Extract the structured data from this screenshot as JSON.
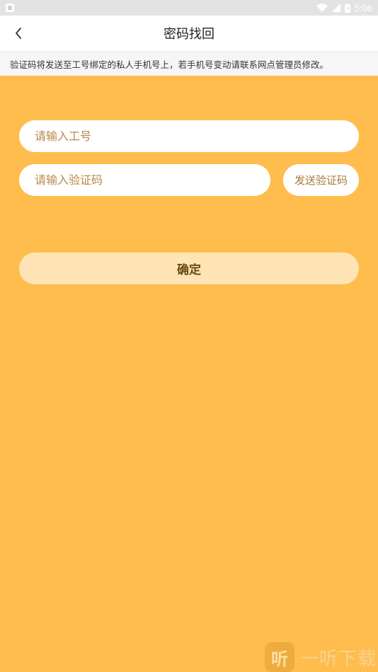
{
  "status_bar": {
    "time": "5:06",
    "icons": [
      "app-notification-icon",
      "wifi-icon",
      "signal-icon",
      "battery-icon"
    ]
  },
  "header": {
    "title": "密码找回",
    "back_icon": "chevron-left-icon"
  },
  "notice": {
    "text": "验证码将发送至工号绑定的私人手机号上，若手机号变动请联系网点管理员修改。"
  },
  "form": {
    "employee_id": {
      "value": "",
      "placeholder": "请输入工号"
    },
    "verification_code": {
      "value": "",
      "placeholder": "请输入验证码"
    },
    "send_code_label": "发送验证码",
    "confirm_label": "确定"
  },
  "watermark": {
    "logo_glyph": "听",
    "text": "一听下载"
  },
  "colors": {
    "background": "#ffbd4d",
    "confirm_bg": "#ffe4b5",
    "confirm_text": "#6b4a10",
    "placeholder": "#b98a4a"
  }
}
